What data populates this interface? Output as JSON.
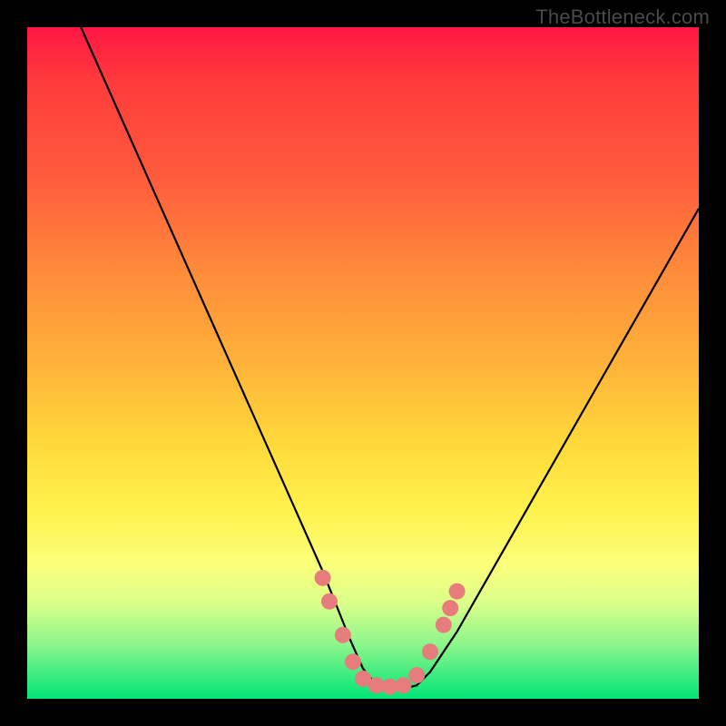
{
  "watermark": "TheBottleneck.com",
  "chart_data": {
    "type": "line",
    "title": "",
    "xlabel": "",
    "ylabel": "",
    "xlim": [
      0,
      100
    ],
    "ylim": [
      0,
      100
    ],
    "series": [
      {
        "name": "curve",
        "x": [
          8,
          12,
          16,
          20,
          24,
          28,
          32,
          36,
          40,
          44,
          46,
          48,
          50,
          52,
          54,
          56,
          58,
          60,
          64,
          68,
          72,
          76,
          80,
          84,
          88,
          92,
          96,
          100
        ],
        "y": [
          100,
          91,
          82,
          73,
          64,
          55,
          46,
          37,
          28,
          19,
          14,
          9,
          4.5,
          2,
          1.5,
          1.5,
          2,
          4,
          10,
          17,
          24,
          31,
          38,
          45,
          52,
          59,
          66,
          73
        ]
      }
    ],
    "markers": [
      {
        "x": 44.0,
        "y": 18.0
      },
      {
        "x": 45.0,
        "y": 14.5
      },
      {
        "x": 47.0,
        "y": 9.5
      },
      {
        "x": 48.5,
        "y": 5.5
      },
      {
        "x": 50.0,
        "y": 3.0
      },
      {
        "x": 52.0,
        "y": 2.0
      },
      {
        "x": 54.0,
        "y": 1.8
      },
      {
        "x": 56.0,
        "y": 2.0
      },
      {
        "x": 58.0,
        "y": 3.5
      },
      {
        "x": 60.0,
        "y": 7.0
      },
      {
        "x": 62.0,
        "y": 11.0
      },
      {
        "x": 63.0,
        "y": 13.5
      },
      {
        "x": 64.0,
        "y": 16.0
      }
    ],
    "gradient_stops": [
      {
        "pct": 0,
        "color": "#ff1744"
      },
      {
        "pct": 22,
        "color": "#ff5a3c"
      },
      {
        "pct": 50,
        "color": "#ffb23a"
      },
      {
        "pct": 72,
        "color": "#fff24d"
      },
      {
        "pct": 86,
        "color": "#d8ff8a"
      },
      {
        "pct": 100,
        "color": "#00e676"
      }
    ],
    "marker_color": "#e77c7c",
    "curve_color": "#000000"
  }
}
